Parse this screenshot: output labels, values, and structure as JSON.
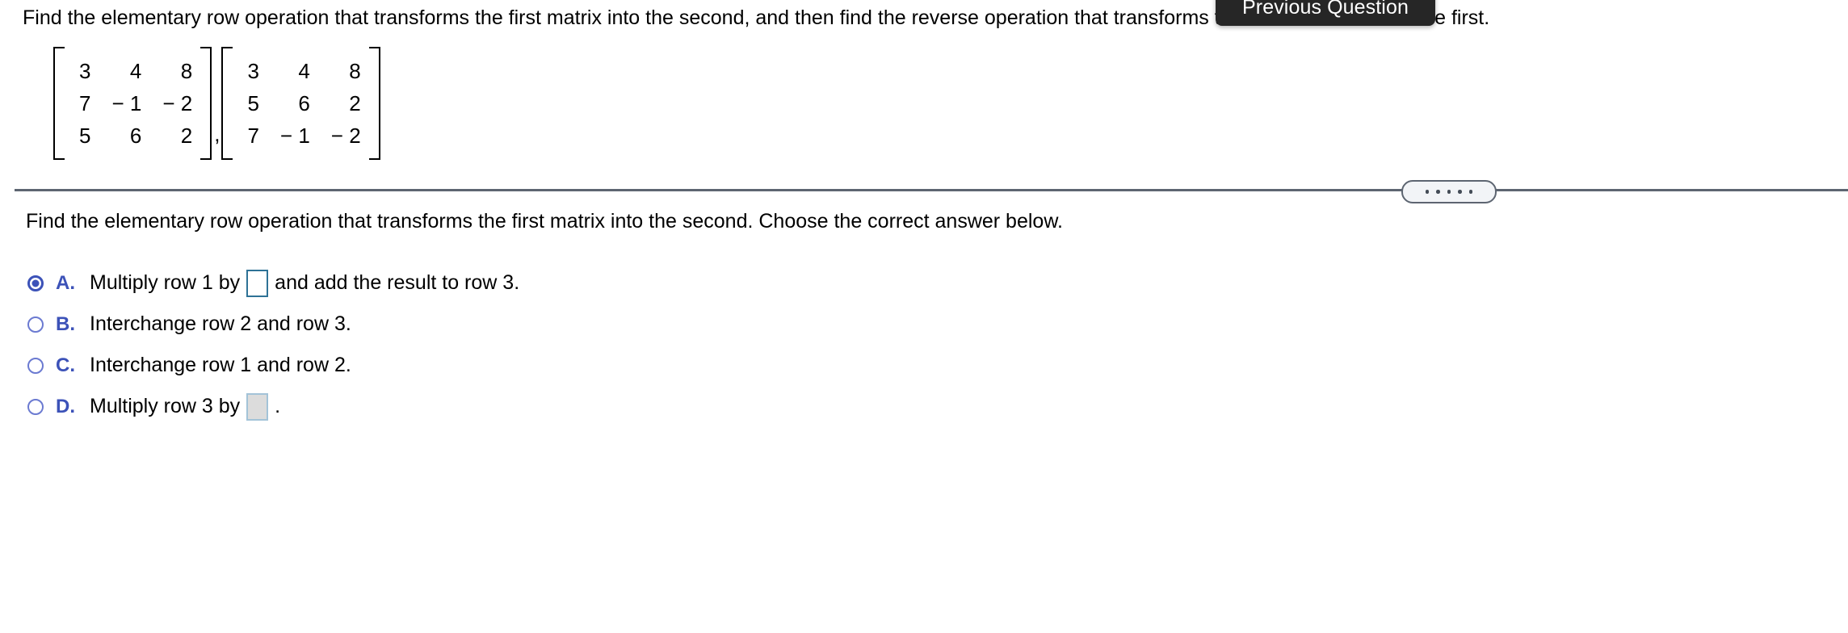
{
  "header": {
    "question_text": "Find the elementary row operation that transforms the first matrix into the second, and then find the reverse operation that transforms the second matrix into the first."
  },
  "tooltip": {
    "label": "Previous Question",
    "background_color": "#262626",
    "text_color": "#ffffff"
  },
  "matrices": {
    "separator": ",",
    "first": {
      "rows": [
        [
          "3",
          "4",
          "8"
        ],
        [
          "7",
          "− 1",
          "− 2"
        ],
        [
          "5",
          "6",
          "2"
        ]
      ]
    },
    "second": {
      "rows": [
        [
          "3",
          "4",
          "8"
        ],
        [
          "5",
          "6",
          "2"
        ],
        [
          "7",
          "− 1",
          "− 2"
        ]
      ]
    }
  },
  "divider": {
    "line_color": "#5d6571",
    "more_dots": [
      "•",
      "•",
      "•",
      "•",
      "•"
    ]
  },
  "prompt": {
    "text": "Find the elementary row operation that transforms the first matrix into the second. Choose the correct answer below."
  },
  "options": [
    {
      "letter": "A.",
      "selected": true,
      "segments": [
        {
          "type": "text",
          "value": "Multiply row 1 by"
        },
        {
          "type": "input",
          "value": "",
          "state": "editable"
        },
        {
          "type": "text",
          "value": "and add the result to row 3."
        }
      ]
    },
    {
      "letter": "B.",
      "selected": false,
      "segments": [
        {
          "type": "text",
          "value": "Interchange row 2 and row 3."
        }
      ]
    },
    {
      "letter": "C.",
      "selected": false,
      "segments": [
        {
          "type": "text",
          "value": "Interchange row 1 and row 2."
        }
      ]
    },
    {
      "letter": "D.",
      "selected": false,
      "segments": [
        {
          "type": "text",
          "value": "Multiply row 3 by"
        },
        {
          "type": "input",
          "value": "",
          "state": "disabled"
        },
        {
          "type": "text",
          "value": "."
        }
      ]
    }
  ],
  "colors": {
    "option_letter": "#3c52b8",
    "radio_selected": "#3c52b8",
    "radio_unselected": "#6b7ad1",
    "answer_box_border": "#2e7296",
    "answer_box_disabled_border": "#a3c3d8",
    "answer_box_disabled_fill": "#dcdcdc"
  }
}
